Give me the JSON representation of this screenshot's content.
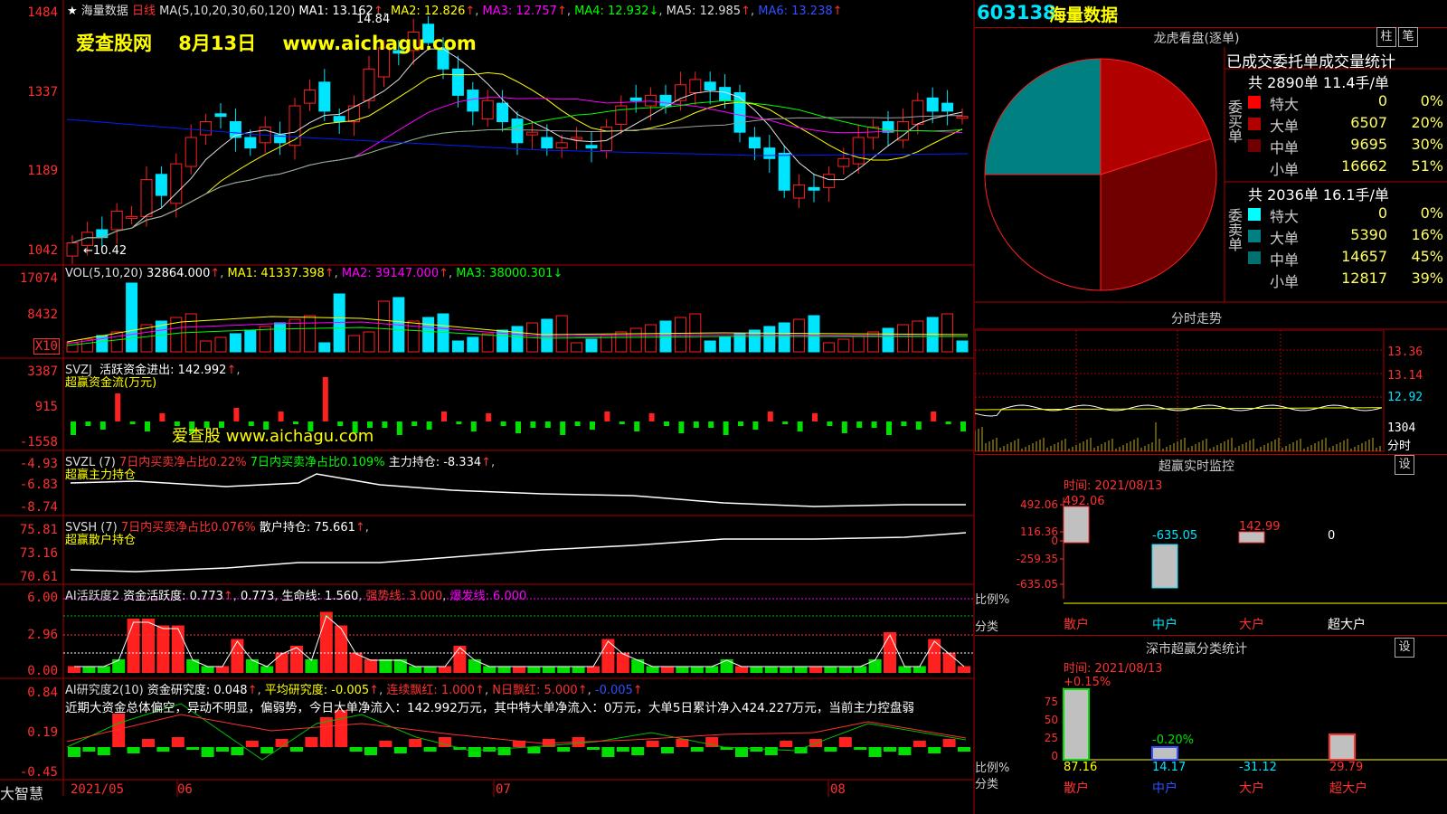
{
  "colors": {
    "up": "#ff2020",
    "down": "#00e5ff",
    "ma1": "#e0e0e0",
    "ma2": "#ffff00",
    "ma3": "#ff00ff",
    "ma4": "#00ff00",
    "ma5": "#a0a0a0",
    "ma6": "#0020ff",
    "grid": "#b00000"
  },
  "main_chart": {
    "stock_name": "海量数据",
    "period": "日线",
    "ma_label": "MA(5,10,20,30,60,120)",
    "ma1": "MA1: 13.162",
    "ma2": "MA2: 12.826",
    "ma3": "MA3: 12.757",
    "ma4": "MA4: 12.932",
    "ma5": "MA5: 12.985",
    "ma6": "MA6: 13.238",
    "high_mark": "14.84",
    "low_mark": "←10.42",
    "watermark": "爱查股网    8月13日    www.aichagu.com",
    "y_ticks": [
      "1484",
      "1337",
      "1189",
      "1042"
    ]
  },
  "vol_chart": {
    "label": "VOL(5,10,20)",
    "value": "32864.000",
    "ma1": "MA1: 41337.398",
    "ma2": "MA2: 39147.000",
    "ma3": "MA3: 38000.301",
    "y_ticks": [
      "17074",
      "8432"
    ],
    "unit": "X10"
  },
  "svzj": {
    "label": "SVZJ",
    "text1": "活跃资金进出: 142.992",
    "text2": "超赢资金流(万元)",
    "watermark": "爱查股 www.aichagu.com",
    "y_ticks": [
      "3387",
      "915",
      "-1558"
    ]
  },
  "svzl": {
    "label": "SVZL (7)",
    "text1": "7日内买卖净占比0.22%",
    "text2": "7日内买卖净占比0.109%",
    "text3": "主力持仓: -8.334",
    "text4": "超赢主力持仓",
    "y_ticks": [
      "-4.93",
      "-6.83",
      "-8.74"
    ]
  },
  "svsh": {
    "label": "SVSH (7)",
    "text1": "7日内买卖净占比0.076%",
    "text2": "散户持仓: 75.661",
    "text3": "超赢散户持仓",
    "y_ticks": [
      "75.81",
      "73.16",
      "70.61"
    ]
  },
  "ai_active": {
    "label": "AI活跃度2",
    "text1": "资金活跃度: 0.773",
    "text2": "0.773",
    "text3": "生命线: 1.560",
    "text4": "强势线: 3.000",
    "text5": "爆发线: 6.000",
    "y_ticks": [
      "6.00",
      "2.96",
      "0.00"
    ]
  },
  "ai_research": {
    "label": "AI研究度2(10)",
    "text1": "资金研究度: 0.048",
    "text2": "平均研究度: -0.005",
    "text3": "连续飘红: 1.000",
    "text4": "N日飘红: 5.000",
    "text5": "-0.005",
    "comment": "近期大资金总体偏空，异动不明显，偏弱势，今日大单净流入：142.992万元，其中特大单净流入：0万元，大单5日累计净入424.227万元，当前主力控盘弱",
    "y_ticks": [
      "0.84",
      "0.19",
      "-0.45"
    ]
  },
  "x_axis": {
    "labels": [
      "2021/05",
      "06",
      "07",
      "08"
    ]
  },
  "logo": "大智慧",
  "stock_header": {
    "code": "603138",
    "name": "海量数据"
  },
  "dragon_tiger": {
    "title": "龙虎看盘(逐单)",
    "btn1": "柱",
    "btn2": "笔",
    "table_title": "已成交委托单成交量统计",
    "buy": {
      "side_label": "委买单",
      "summary": "共 2890单 11.4手/单",
      "rows": [
        {
          "type": "特大",
          "count": "0",
          "pct": "0%",
          "color": "#ff0000"
        },
        {
          "type": "大单",
          "count": "6507",
          "pct": "20%",
          "color": "#b00000"
        },
        {
          "type": "中单",
          "count": "9695",
          "pct": "30%",
          "color": "#700000"
        },
        {
          "type": "小单",
          "count": "16662",
          "pct": "51%",
          "color": "#000000"
        }
      ]
    },
    "sell": {
      "side_label": "委卖单",
      "summary": "共 2036单 16.1手/单",
      "rows": [
        {
          "type": "特大",
          "count": "0",
          "pct": "0%",
          "color": "#00ffff"
        },
        {
          "type": "大单",
          "count": "5390",
          "pct": "16%",
          "color": "#008080"
        },
        {
          "type": "中单",
          "count": "14657",
          "pct": "45%",
          "color": "#007070"
        },
        {
          "type": "小单",
          "count": "12817",
          "pct": "39%",
          "color": "#000000"
        }
      ]
    }
  },
  "intraday": {
    "title": "分时走势",
    "y_ticks": [
      "13.36",
      "13.14",
      "12.92",
      "1304",
      "分时"
    ]
  },
  "monitor": {
    "title": "超赢实时监控",
    "btn": "设",
    "time": "时间: 2021/08/13",
    "y_ticks": [
      "492.06",
      "116.36",
      "0",
      "-259.35",
      "-635.05"
    ],
    "values": [
      {
        "label": "散户",
        "value": "492.06"
      },
      {
        "label": "中户",
        "value": "-635.05"
      },
      {
        "label": "大户",
        "value": "142.99"
      },
      {
        "label": "超大户",
        "value": "0"
      }
    ],
    "ratio_label": "比例%",
    "class_label": "分类"
  },
  "shenzhen": {
    "title": "深市超赢分类统计",
    "btn": "设",
    "time": "时间: 2021/08/13",
    "top_value": "+0.15%",
    "mid_value": "-0.20%",
    "y_ticks": [
      "75",
      "50",
      "25",
      "0"
    ],
    "values": [
      {
        "label": "散户",
        "value": "87.16"
      },
      {
        "label": "中户",
        "value": "14.17"
      },
      {
        "label": "大户",
        "value": "-31.12"
      },
      {
        "label": "超大户",
        "value": "29.79"
      }
    ],
    "ratio_label": "比例%",
    "class_label": "分类"
  }
}
